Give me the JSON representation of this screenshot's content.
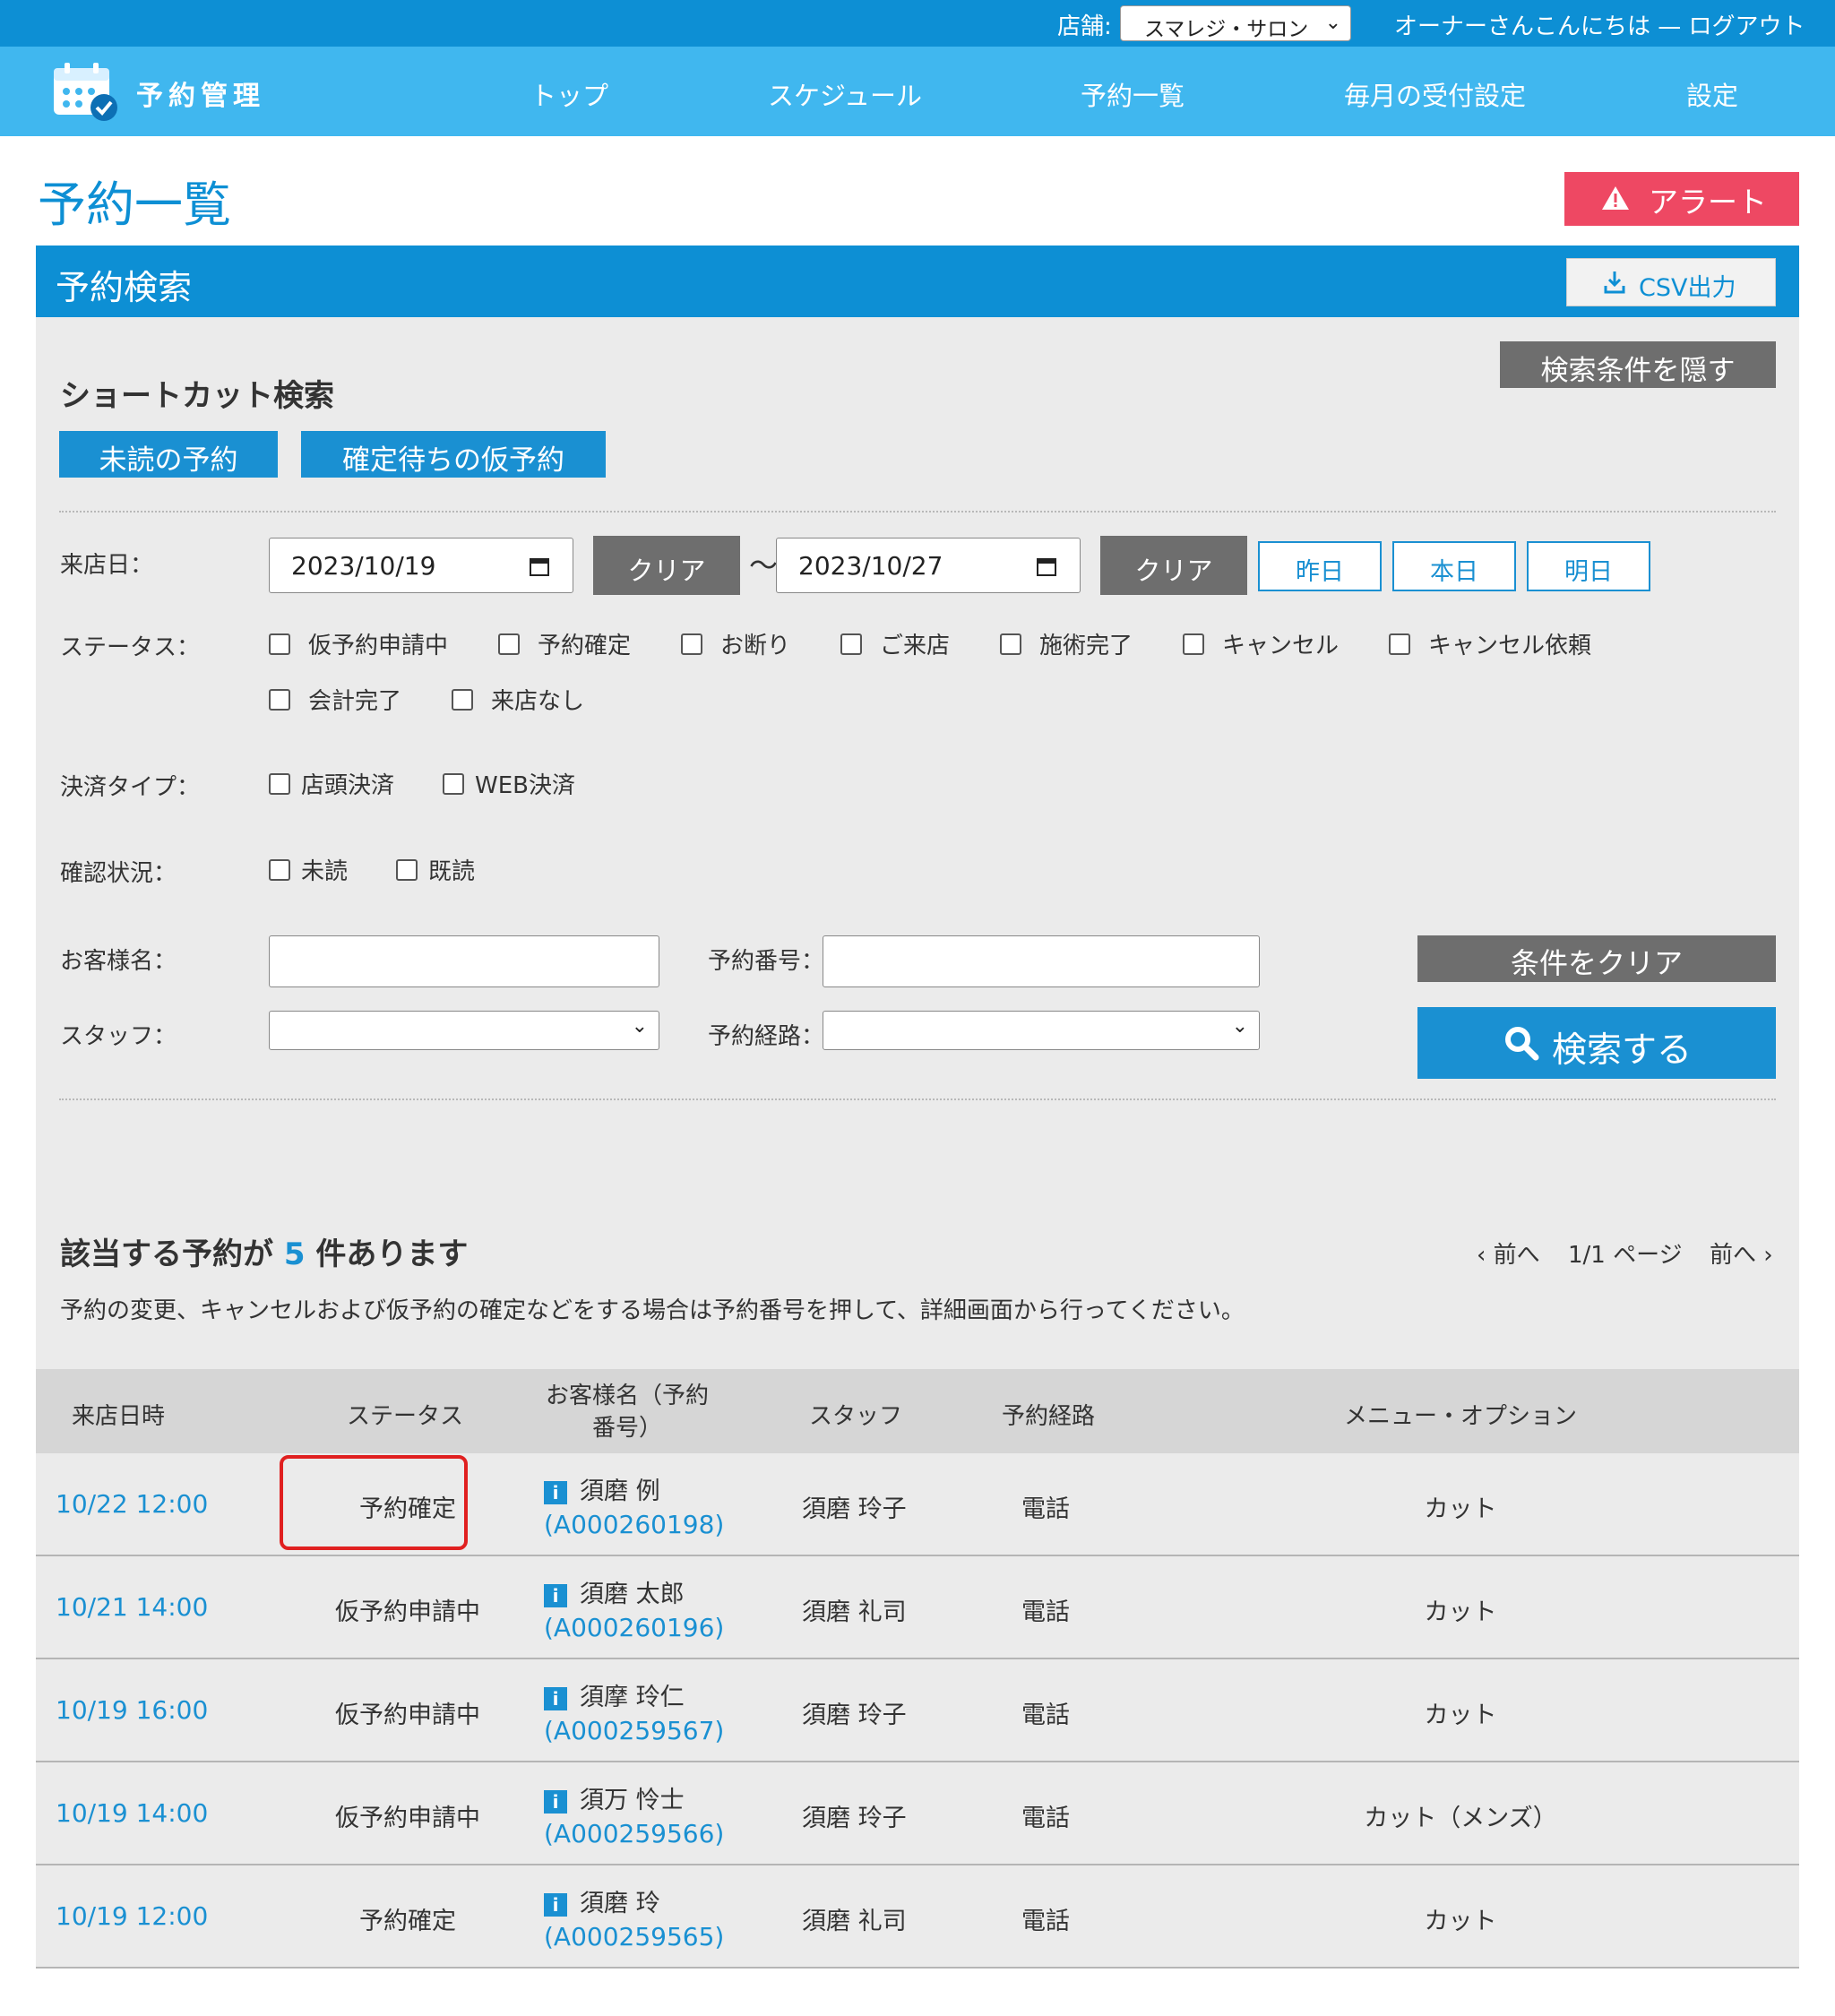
{
  "topbar": {
    "store_label": "店舗:",
    "store_value": "スマレジ・サロン",
    "greeting": "オーナーさんこんにちは — ログアウト"
  },
  "nav": {
    "brand": "予約管理",
    "items": [
      "トップ",
      "スケジュール",
      "予約一覧",
      "毎月の受付設定",
      "設定"
    ]
  },
  "page": {
    "title": "予約一覧",
    "alert_label": "アラート"
  },
  "search": {
    "title": "予約検索",
    "csv_label": "CSV出力",
    "hide_label": "検索条件を隠す",
    "shortcut_title": "ショートカット検索",
    "shortcuts": [
      "未読の予約",
      "確定待ちの仮予約"
    ],
    "visit_date_label": "来店日：",
    "date_from": "2023/10/19",
    "date_to": "2023/10/27",
    "clear_label": "クリア",
    "tilde": "〜",
    "day_buttons": [
      "昨日",
      "本日",
      "明日"
    ],
    "status_label": "ステータス：",
    "statuses": [
      "仮予約申請中",
      "予約確定",
      "お断り",
      "ご来店",
      "施術完了",
      "キャンセル",
      "キャンセル依頼",
      "会計完了",
      "来店なし"
    ],
    "payment_label": "決済タイプ：",
    "payments": [
      "店頭決済",
      "WEB決済"
    ],
    "confirm_label": "確認状況：",
    "confirms": [
      "未読",
      "既読"
    ],
    "customer_label": "お客様名：",
    "customer_value": "",
    "resnum_label": "予約番号：",
    "resnum_value": "",
    "staff_label": "スタッフ：",
    "staff_value": "",
    "route_label": "予約経路：",
    "route_value": "",
    "clear_cond_label": "条件をクリア",
    "search_label": "検索する"
  },
  "results": {
    "title_prefix": "該当する予約が",
    "count": "5",
    "title_suffix": "件あります",
    "prev_label": "‹ 前へ",
    "page_info": "1/1 ページ",
    "next_label": "前へ ›",
    "note": "予約の変更、キャンセルおよび仮予約の確定などをする場合は予約番号を押して、詳細画面から行ってください。",
    "columns": [
      "来店日時",
      "ステータス",
      "お客様名（予約番号）",
      "スタッフ",
      "予約経路",
      "メニュー・オプション"
    ],
    "rows": [
      {
        "date": "10/22 12:00",
        "status": "予約確定",
        "name": "須磨 例",
        "number": "(A000260198)",
        "staff": "須磨 玲子",
        "route": "電話",
        "menu": "カット"
      },
      {
        "date": "10/21 14:00",
        "status": "仮予約申請中",
        "name": "須磨 太郎",
        "number": "(A000260196)",
        "staff": "須磨 礼司",
        "route": "電話",
        "menu": "カット"
      },
      {
        "date": "10/19 16:00",
        "status": "仮予約申請中",
        "name": "須摩 玲仁",
        "number": "(A000259567)",
        "staff": "須磨 玲子",
        "route": "電話",
        "menu": "カット"
      },
      {
        "date": "10/19 14:00",
        "status": "仮予約申請中",
        "name": "須万 怜士",
        "number": "(A000259566)",
        "staff": "須磨 玲子",
        "route": "電話",
        "menu": "カット（メンズ）"
      },
      {
        "date": "10/19 12:00",
        "status": "予約確定",
        "name": "須磨 玲",
        "number": "(A000259565)",
        "staff": "須磨 礼司",
        "route": "電話",
        "menu": "カット"
      }
    ]
  }
}
